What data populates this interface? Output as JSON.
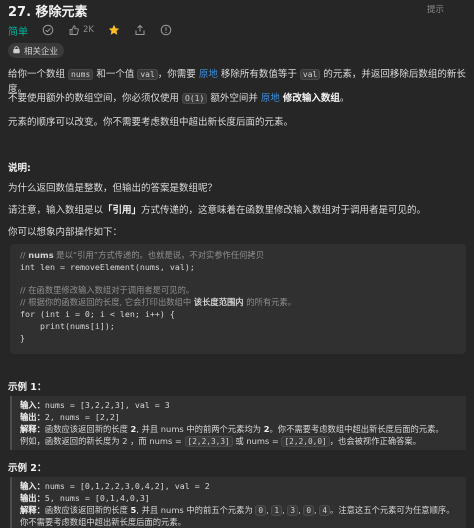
{
  "header": {
    "title": "27. 移除元素",
    "hint_label": "提示"
  },
  "meta": {
    "difficulty": "简单",
    "like_count": "2K",
    "colors": {
      "easy": "#00af9b",
      "accent": "#3e8ede",
      "star": "#ffc01e"
    }
  },
  "company_tag": {
    "label": "相关企业"
  },
  "description": {
    "p1": {
      "a": "给你一个数组 ",
      "code_nums": "nums",
      "b": " 和一个值 ",
      "code_val": "val",
      "c": "，你需要 ",
      "link": "原地",
      "d": " 移除所有数值等于 ",
      "code_val2": "val",
      "e": " 的元素，并返回移除后数组的新长度。"
    },
    "p2": {
      "a": "不要使用额外的数组空间，你必须仅使用 ",
      "code": "O(1)",
      "b": " 额外空间并 ",
      "link": "原地",
      "c": " ",
      "bold": "修改输入数组",
      "d": "。"
    },
    "p3": "元素的顺序可以改变。你不需要考虑数组中超出新长度后面的元素。"
  },
  "explain": {
    "heading": "说明:",
    "q": "为什么返回数值是整数，但输出的答案是数组呢？",
    "p_a": "请注意，输入数组是以",
    "p_bold": "「引用」",
    "p_b": "方式传递的，这意味着在函数里修改输入数组对于调用者是可见的。",
    "p2": "你可以想象内部操作如下："
  },
  "code": {
    "l1_a": "// ",
    "l1_bold": "nums",
    "l1_b": " 是以“引用”方式传递的。也就是说，不对实参作任何拷贝",
    "l2": "int len = removeElement(nums, val);",
    "l3": "// 在函数里修改输入数组对于调用者是可见的。",
    "l4_a": "// 根据你的函数返回的长度, 它会打印出数组中 ",
    "l4_bold": "该长度范围内",
    "l4_b": " 的所有元素。",
    "l5": "for (int i = 0; i < len; i++) {",
    "l6": "    print(nums[i]);",
    "l7": "}"
  },
  "example1": {
    "heading": "示例 1：",
    "input_label": "输入：",
    "input_value": "nums = [3,2,2,3], val = 3",
    "output_label": "输出：",
    "output_value": "2, nums = [2,2]",
    "explain_label": "解释：",
    "explain_a": "函数应该返回新的长度 ",
    "explain_a_num": "2",
    "explain_b": ", 并且 nums 中的前两个元素均为 ",
    "explain_b_num": "2",
    "explain_c": "。你不需要考虑数组中超出新长度后面的元素。",
    "line2_a": "例如，函数返回的新长度为 2 ，而 nums = ",
    "line2_code1": "[2,2,3,3]",
    "line2_b": " 或 nums = ",
    "line2_code2": "[2,2,0,0]",
    "line2_c": "，也会被视作正确答案。"
  },
  "example2": {
    "heading": "示例 2：",
    "input_label": "输入：",
    "input_value": "nums = [0,1,2,2,3,0,4,2], val = 2",
    "output_label": "输出：",
    "output_value": "5, nums = [0,1,4,0,3]",
    "explain_label": "解释：",
    "explain_a": "函数应该返回新的长度 ",
    "explain_a_num": "5",
    "explain_b": ", 并且 nums 中的前五个元素为 ",
    "codes": [
      "0",
      "1",
      "3",
      "0",
      "4"
    ],
    "explain_c": "。注意这五个元素可为任意顺序。",
    "line2": "你不需要考虑数组中超出新长度后面的元素。"
  }
}
